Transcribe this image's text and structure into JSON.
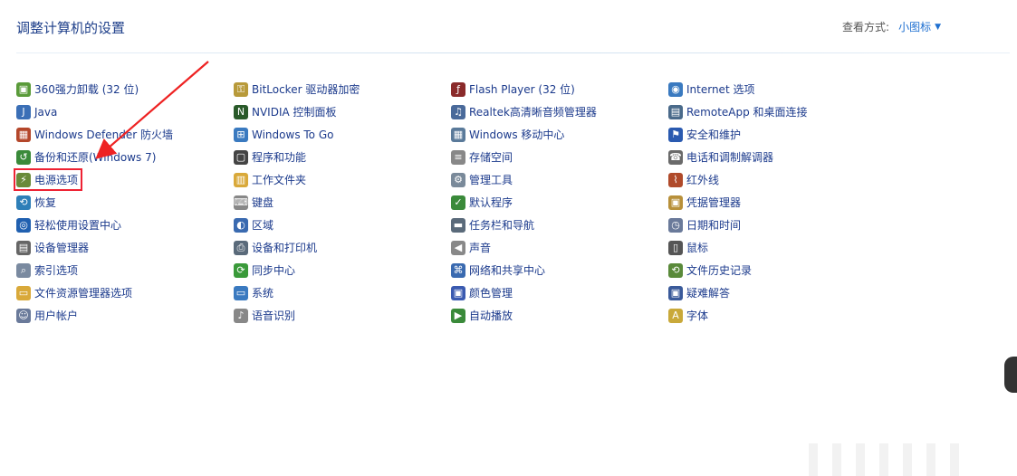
{
  "page": {
    "title": "调整计算机的设置",
    "view_label": "查看方式:",
    "view_value": "小图标",
    "view_dropdown_icon": "chevron-down-icon"
  },
  "colors": {
    "title": "#1e3f8a",
    "link": "#1b3a8c",
    "view_value": "#1e6fd0",
    "highlight": "#e82c2c"
  },
  "columns": [
    [
      {
        "label": "360强力卸载 (32 位)",
        "icon": "uninstall-icon",
        "color": "#5a9b3a",
        "glyph": "▣"
      },
      {
        "label": "Java",
        "icon": "java-icon",
        "color": "#3b6fb6",
        "glyph": "J"
      },
      {
        "label": "Windows Defender 防火墙",
        "icon": "firewall-icon",
        "color": "#b4472b",
        "glyph": "▦"
      },
      {
        "label": "备份和还原(Windows 7)",
        "icon": "backup-icon",
        "color": "#3a8a3a",
        "glyph": "↺"
      },
      {
        "label": "电源选项",
        "icon": "power-options-icon",
        "color": "#6a8a3a",
        "glyph": "⚡",
        "highlight": true
      },
      {
        "label": "恢复",
        "icon": "recovery-icon",
        "color": "#2e7fb8",
        "glyph": "⟲"
      },
      {
        "label": "轻松使用设置中心",
        "icon": "ease-of-access-icon",
        "color": "#2060b0",
        "glyph": "◎"
      },
      {
        "label": "设备管理器",
        "icon": "device-manager-icon",
        "color": "#666666",
        "glyph": "▤"
      },
      {
        "label": "索引选项",
        "icon": "indexing-icon",
        "color": "#7a8aa0",
        "glyph": "⌕"
      },
      {
        "label": "文件资源管理器选项",
        "icon": "folder-options-icon",
        "color": "#d9a93a",
        "glyph": "▭"
      },
      {
        "label": "用户帐户",
        "icon": "user-accounts-icon",
        "color": "#6a7a9a",
        "glyph": "☺"
      }
    ],
    [
      {
        "label": "BitLocker 驱动器加密",
        "icon": "bitlocker-icon",
        "color": "#b89a3a",
        "glyph": "⚿"
      },
      {
        "label": "NVIDIA 控制面板",
        "icon": "nvidia-icon",
        "color": "#2a5a2a",
        "glyph": "N"
      },
      {
        "label": "Windows To Go",
        "icon": "windows-to-go-icon",
        "color": "#3a7ac0",
        "glyph": "⊞"
      },
      {
        "label": "程序和功能",
        "icon": "programs-icon",
        "color": "#444444",
        "glyph": "▢"
      },
      {
        "label": "工作文件夹",
        "icon": "work-folders-icon",
        "color": "#d9a93a",
        "glyph": "▥"
      },
      {
        "label": "键盘",
        "icon": "keyboard-icon",
        "color": "#888888",
        "glyph": "⌨"
      },
      {
        "label": "区域",
        "icon": "region-icon",
        "color": "#3a6ab0",
        "glyph": "◐"
      },
      {
        "label": "设备和打印机",
        "icon": "printer-icon",
        "color": "#5a6a7a",
        "glyph": "⎙"
      },
      {
        "label": "同步中心",
        "icon": "sync-icon",
        "color": "#3a9a3a",
        "glyph": "⟳"
      },
      {
        "label": "系统",
        "icon": "system-icon",
        "color": "#3a7ac0",
        "glyph": "▭"
      },
      {
        "label": "语音识别",
        "icon": "microphone-icon",
        "color": "#888888",
        "glyph": "♪"
      }
    ],
    [
      {
        "label": "Flash Player (32 位)",
        "icon": "flash-icon",
        "color": "#8a2a2a",
        "glyph": "ƒ"
      },
      {
        "label": "Realtek高清晰音频管理器",
        "icon": "audio-manager-icon",
        "color": "#4a6a9a",
        "glyph": "♫"
      },
      {
        "label": "Windows 移动中心",
        "icon": "mobility-center-icon",
        "color": "#5a7a9a",
        "glyph": "▦"
      },
      {
        "label": "存储空间",
        "icon": "storage-icon",
        "color": "#888888",
        "glyph": "≡"
      },
      {
        "label": "管理工具",
        "icon": "admin-tools-icon",
        "color": "#7a8a9a",
        "glyph": "⚙"
      },
      {
        "label": "默认程序",
        "icon": "default-programs-icon",
        "color": "#3a8a3a",
        "glyph": "✓"
      },
      {
        "label": "任务栏和导航",
        "icon": "taskbar-icon",
        "color": "#5a6a7a",
        "glyph": "▬"
      },
      {
        "label": "声音",
        "icon": "speaker-icon",
        "color": "#888888",
        "glyph": "◀"
      },
      {
        "label": "网络和共享中心",
        "icon": "network-icon",
        "color": "#3a6ab0",
        "glyph": "⌘"
      },
      {
        "label": "颜色管理",
        "icon": "color-management-icon",
        "color": "#3a5ab0",
        "glyph": "▣"
      },
      {
        "label": "自动播放",
        "icon": "autoplay-icon",
        "color": "#3a8a3a",
        "glyph": "▶"
      }
    ],
    [
      {
        "label": "Internet 选项",
        "icon": "internet-options-icon",
        "color": "#3a7ac0",
        "glyph": "◉"
      },
      {
        "label": "RemoteApp 和桌面连接",
        "icon": "remoteapp-icon",
        "color": "#4a6a8a",
        "glyph": "▤"
      },
      {
        "label": "安全和维护",
        "icon": "flag-icon",
        "color": "#2a5ab0",
        "glyph": "⚑"
      },
      {
        "label": "电话和调制解调器",
        "icon": "phone-modem-icon",
        "color": "#6a6a6a",
        "glyph": "☎"
      },
      {
        "label": "红外线",
        "icon": "infrared-icon",
        "color": "#b04a2a",
        "glyph": "⌇"
      },
      {
        "label": "凭据管理器",
        "icon": "credential-manager-icon",
        "color": "#b8903a",
        "glyph": "▣"
      },
      {
        "label": "日期和时间",
        "icon": "clock-icon",
        "color": "#6a7a9a",
        "glyph": "◷"
      },
      {
        "label": "鼠标",
        "icon": "mouse-icon",
        "color": "#555555",
        "glyph": "▯"
      },
      {
        "label": "文件历史记录",
        "icon": "file-history-icon",
        "color": "#5a8a3a",
        "glyph": "⟲"
      },
      {
        "label": "疑难解答",
        "icon": "troubleshooting-icon",
        "color": "#3a5a9a",
        "glyph": "▣"
      },
      {
        "label": "字体",
        "icon": "font-icon",
        "color": "#c9a93a",
        "glyph": "A"
      }
    ]
  ]
}
